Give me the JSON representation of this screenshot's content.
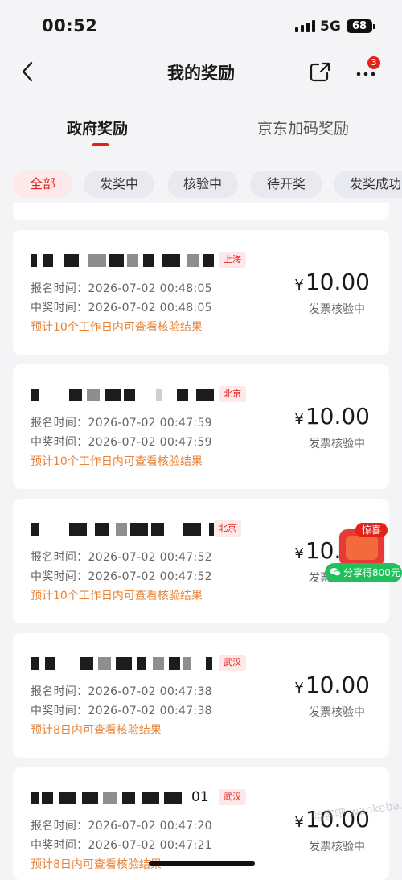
{
  "status_bar": {
    "time": "00:52",
    "network": "5G",
    "battery": "68"
  },
  "nav": {
    "title": "我的奖励",
    "notification_count": "3"
  },
  "tabs": [
    {
      "label": "政府奖励"
    },
    {
      "label": "京东加码奖励"
    }
  ],
  "filters": [
    {
      "label": "全部"
    },
    {
      "label": "发奖中"
    },
    {
      "label": "核验中"
    },
    {
      "label": "待开奖"
    },
    {
      "label": "发奖成功"
    }
  ],
  "records": [
    {
      "city": "上海",
      "signup": "报名时间：2026-07-02 00:48:05",
      "win": "中奖时间：2026-07-02 00:48:05",
      "hint": "预计10个工作日内可查看核验结果",
      "currency": "¥",
      "amount": "10.00",
      "status": "发票核验中"
    },
    {
      "city": "北京",
      "signup": "报名时间：2026-07-02 00:47:59",
      "win": "中奖时间：2026-07-02 00:47:59",
      "hint": "预计10个工作日内可查看核验结果",
      "currency": "¥",
      "amount": "10.00",
      "status": "发票核验中"
    },
    {
      "city": "北京",
      "signup": "报名时间：2026-07-02 00:47:52",
      "win": "中奖时间：2026-07-02 00:47:52",
      "hint": "预计10个工作日内可查看核验结果",
      "currency": "¥",
      "amount": "10.00",
      "status": "发票核验中"
    },
    {
      "city": "武汉",
      "signup": "报名时间：2026-07-02 00:47:38",
      "win": "中奖时间：2026-07-02 00:47:38",
      "hint": "预计8日内可查看核验结果",
      "currency": "¥",
      "amount": "10.00",
      "status": "发票核验中"
    },
    {
      "city": "武汉",
      "name_suffix": "01",
      "signup": "报名时间：2026-07-02 00:47:20",
      "win": "中奖时间：2026-07-02 00:47:21",
      "hint": "预计8日内可查看核验结果",
      "currency": "¥",
      "amount": "10.00",
      "status": "发票核验中"
    }
  ],
  "promo": {
    "tag": "惊喜",
    "share_label": "分享得800元"
  },
  "watermark": "嘻客吧 wankeba.com",
  "colors": {
    "accent": "#e2231a",
    "hint": "#e7843a",
    "share_green": "#20c05c"
  }
}
